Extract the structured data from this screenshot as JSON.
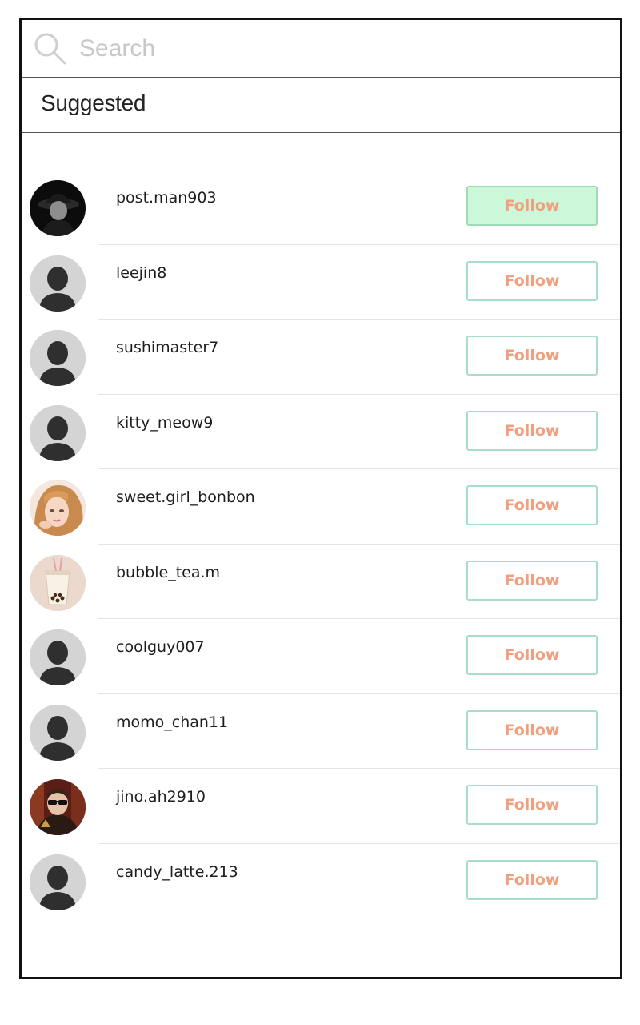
{
  "search": {
    "placeholder": "Search",
    "value": ""
  },
  "section": {
    "title": "Suggested"
  },
  "colors": {
    "follow_text": "#f0a080",
    "follow_border": "#a8ddc8",
    "follow_active_bg": "#ccf7d8",
    "avatar_placeholder": "#d4d4d4"
  },
  "users": [
    {
      "username": "post.man903",
      "follow_label": "Follow",
      "avatar": "photo-dark-hat",
      "highlighted": true
    },
    {
      "username": "leejin8",
      "follow_label": "Follow",
      "avatar": "default-silhouette"
    },
    {
      "username": "sushimaster7",
      "follow_label": "Follow",
      "avatar": "default-silhouette"
    },
    {
      "username": "kitty_meow9",
      "follow_label": "Follow",
      "avatar": "default-silhouette"
    },
    {
      "username": "sweet.girl_bonbon",
      "follow_label": "Follow",
      "avatar": "photo-girl-illustration"
    },
    {
      "username": "bubble_tea.m",
      "follow_label": "Follow",
      "avatar": "photo-bubble-tea"
    },
    {
      "username": "coolguy007",
      "follow_label": "Follow",
      "avatar": "default-silhouette"
    },
    {
      "username": "momo_chan11",
      "follow_label": "Follow",
      "avatar": "default-silhouette"
    },
    {
      "username": "jino.ah2910",
      "follow_label": "Follow",
      "avatar": "photo-sunglasses-man"
    },
    {
      "username": "candy_latte.213",
      "follow_label": "Follow",
      "avatar": "default-silhouette"
    }
  ]
}
